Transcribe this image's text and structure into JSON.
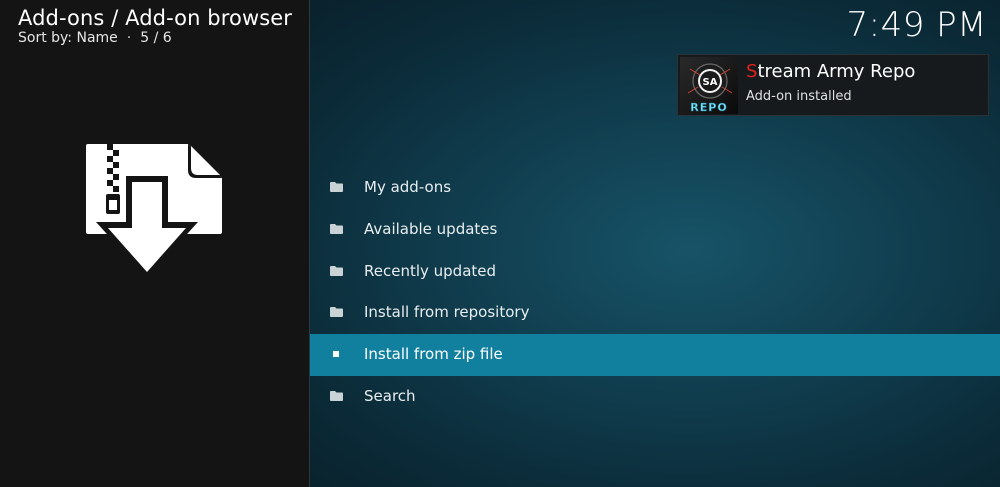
{
  "header": {
    "title": "Add-ons / Add-on browser",
    "sort_label": "Sort by: Name",
    "position": "5 / 6"
  },
  "clock": "7:49 PM",
  "left_icon": "install-from-zip-icon",
  "notification": {
    "title_first": "S",
    "title_rest": "tream Army Repo",
    "message": "Add-on installed",
    "thumbnail_text": "REPO",
    "thumbnail_icon": "stream-army-logo-icon"
  },
  "menu": {
    "items": [
      {
        "label": "My add-ons",
        "icon": "folder-icon"
      },
      {
        "label": "Available updates",
        "icon": "folder-icon"
      },
      {
        "label": "Recently updated",
        "icon": "folder-icon"
      },
      {
        "label": "Install from repository",
        "icon": "folder-icon"
      },
      {
        "label": "Install from zip file",
        "icon": "bullet-icon"
      },
      {
        "label": "Search",
        "icon": "folder-icon"
      }
    ],
    "selected_index": 4
  },
  "colors": {
    "highlight": "#11809f",
    "background": "#103d4e",
    "left_panel": "#141414",
    "brand_red": "#e0231f"
  }
}
